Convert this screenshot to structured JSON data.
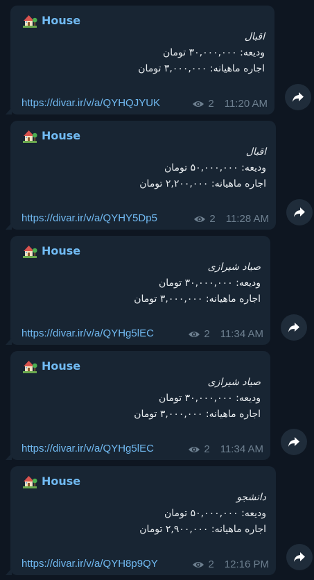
{
  "messages": [
    {
      "sender": "House",
      "title": "اقبال",
      "deposit": "ودیعه: ۳۰,۰۰۰,۰۰۰ تومان",
      "rent": "اجاره ماهیانه: ۳,۰۰۰,۰۰۰ تومان",
      "link": "https://divar.ir/v/a/QYHQJYUK",
      "views": "2",
      "time": "11:20 AM"
    },
    {
      "sender": "House",
      "title": "اقبال",
      "deposit": "ودیعه: ۵۰,۰۰۰,۰۰۰ تومان",
      "rent": "اجاره ماهیانه: ۲,۲۰۰,۰۰۰ تومان",
      "link": "https://divar.ir/v/a/QYHY5Dp5",
      "views": "2",
      "time": "11:28 AM"
    },
    {
      "sender": "House",
      "title": "صیاد شیرازی",
      "deposit": "ودیعه: ۳۰,۰۰۰,۰۰۰ تومان",
      "rent": "اجاره ماهیانه: ۳,۰۰۰,۰۰۰ تومان",
      "link": "https://divar.ir/v/a/QYHg5lEC",
      "views": "2",
      "time": "11:34 AM"
    },
    {
      "sender": "House",
      "title": "صیاد شیرازی",
      "deposit": "ودیعه: ۳۰,۰۰۰,۰۰۰ تومان",
      "rent": "اجاره ماهیانه: ۳,۰۰۰,۰۰۰ تومان",
      "link": "https://divar.ir/v/a/QYHg5lEC",
      "views": "2",
      "time": "11:34 AM"
    },
    {
      "sender": "House",
      "title": "دانشجو",
      "deposit": "ودیعه: ۵۰,۰۰۰,۰۰۰ تومان",
      "rent": "اجاره ماهیانه: ۲,۹۰۰,۰۰۰ تومان",
      "link": "https://divar.ir/v/a/QYH8p9QY",
      "views": "2",
      "time": "12:16 PM"
    }
  ],
  "icons": {
    "sender": "house-with-garden-icon",
    "views": "eye-icon",
    "share": "share-arrow-icon"
  },
  "colors": {
    "background": "#0e1621",
    "bubble": "#182533",
    "accent": "#71baf2",
    "text": "#e8ecef",
    "meta": "#6d7f8f",
    "share_button": "#1f2c3a"
  }
}
